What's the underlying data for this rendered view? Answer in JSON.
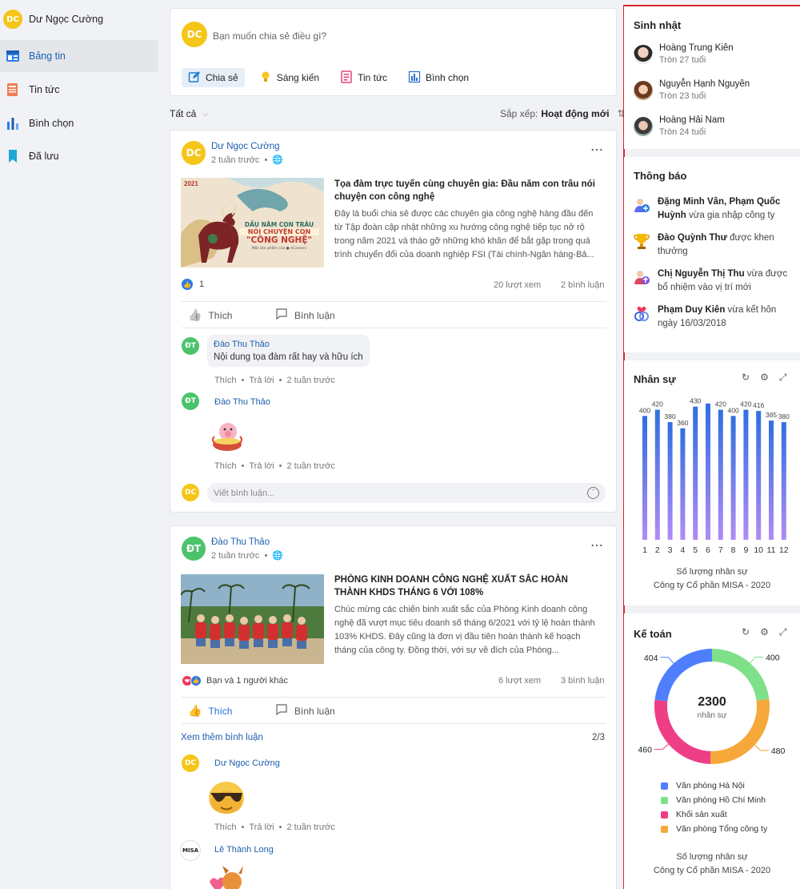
{
  "sidebar": {
    "user": {
      "initials": "DC",
      "name": "Dư Ngọc Cường"
    },
    "items": [
      {
        "label": "Bảng tin",
        "icon": "newsfeed-icon",
        "active": true
      },
      {
        "label": "Tin tức",
        "icon": "news-icon",
        "active": false
      },
      {
        "label": "Bình chọn",
        "icon": "poll-icon",
        "active": false
      },
      {
        "label": "Đã lưu",
        "icon": "bookmark-icon",
        "active": false
      }
    ]
  },
  "composer": {
    "initials": "DC",
    "placeholder": "Bạn muốn chia sẻ điều gì?",
    "tabs": [
      {
        "label": "Chia sẻ",
        "icon": "share-edit-icon"
      },
      {
        "label": "Sáng kiến",
        "icon": "lightbulb-icon"
      },
      {
        "label": "Tin tức",
        "icon": "news-icon"
      },
      {
        "label": "Bình chọn",
        "icon": "poll-icon"
      }
    ]
  },
  "filter": {
    "label": "Tất cả",
    "sort_prefix": "Sắp xếp:",
    "sort_value": "Hoạt động mới"
  },
  "posts": [
    {
      "author": "Dư Ngọc Cường",
      "initials": "DC",
      "time": "2 tuần trước",
      "title": "Tọa đàm trực tuyến cùng chuyên gia: Đầu năm con trâu nói chuyện con công nghệ",
      "excerpt": "Đây là buổi chia sẻ được các chuyên gia công nghệ hàng đầu đến từ Tập đoàn cập nhật những xu hướng công nghệ tiếp tục nở rộ trong năm 2021 và tháo gỡ những khó khăn để bắt gặp trong quá trình chuyển đổi của doanh nghiệp FSI (Tài chính-Ngân hàng-Bả...",
      "image_caption": {
        "year": "2021",
        "line1": "DẦU NĂM CON TRÂU",
        "line2": "NÓI CHUYỆN CON",
        "line3": "\"CÔNG NGHỆ\"",
        "footer": "Một sản phẩm của ● eCareers"
      },
      "reactions": "1",
      "views": "20 lượt xem",
      "comments": "2 bình luận",
      "like_label": "Thích",
      "comment_label": "Bình luận",
      "comment_list": [
        {
          "author": "Đào Thu Thảo",
          "initials": "ĐT",
          "text": "Nội dung tọa đàm rất hay và hữu ích",
          "like": "Thích",
          "reply": "Trả lời",
          "time": "2 tuần trước"
        },
        {
          "author": "Đào Thu Thảo",
          "initials": "ĐT",
          "sticker": "pig-sticker",
          "like": "Thích",
          "reply": "Trả lời",
          "time": "2 tuần trước"
        }
      ],
      "comment_input": {
        "initials": "DC",
        "placeholder": "Viết bình luận..."
      }
    },
    {
      "author": "Đào Thu Thảo",
      "initials": "ĐT",
      "time": "2 tuần trước",
      "title": "PHÒNG KINH DOANH CÔNG NGHỆ XUẤT SẮC HOÀN THÀNH KHDS THÁNG 6 VỚI 108%",
      "excerpt": "Chúc mừng các chiến binh xuất sắc của Phòng Kinh doanh công nghệ đã vượt mục tiêu doanh số tháng 6/2021 với tỷ lệ hoàn thành 103% KHDS. Đây cũng là đơn vị đầu tiên hoàn thành kế hoạch tháng của công ty. Đồng thời, với sự về đích của Phòng...",
      "reactions": "Bạn và 1 người khác",
      "views": "6 lượt xem",
      "comments": "3 bình luận",
      "like_label": "Thích",
      "comment_label": "Bình luận",
      "more_comments": "Xem thêm bình luận",
      "more_count": "2/3",
      "comment_list": [
        {
          "author": "Dư Ngọc Cường",
          "initials": "DC",
          "sticker": "sunglasses-sticker",
          "like": "Thích",
          "reply": "Trả lời",
          "time": "2 tuần trước"
        },
        {
          "author": "Lê Thành Long",
          "logo": "MISA",
          "sticker": "dog-sticker"
        }
      ]
    }
  ],
  "birthdays": {
    "title": "Sinh nhật",
    "people": [
      {
        "name": "Hoàng Trung Kiên",
        "age": "Tròn 27 tuổi"
      },
      {
        "name": "Nguyễn Hạnh Nguyên",
        "age": "Tròn 23 tuổi"
      },
      {
        "name": "Hoàng Hải Nam",
        "age": "Tròn 24 tuổi"
      }
    ]
  },
  "notifications": {
    "title": "Thông báo",
    "items": [
      {
        "icon": "new-member-icon",
        "bold": "Đặng Minh Vân, Phạm Quốc Huỳnh",
        "rest": " vừa gia nhập công ty"
      },
      {
        "icon": "trophy-icon",
        "bold": "Đào Quỳnh Thư",
        "rest": " được khen thưởng"
      },
      {
        "icon": "promotion-icon",
        "bold": "Chị Nguyễn Thị Thu",
        "rest": " vừa được bổ nhiệm vào vị trí mới"
      },
      {
        "icon": "wedding-rings-icon",
        "bold": "Phạm Duy Kiên",
        "rest": " vừa kết hôn ngày 16/03/2018"
      }
    ]
  },
  "hr_widget": {
    "title": "Nhân sự",
    "caption1": "Số lượng nhân sự",
    "caption2": "Công ty Cổ phần MISA - 2020"
  },
  "acc_widget": {
    "title": "Kế toán",
    "center_value": "2300",
    "center_label": "nhân sự",
    "caption1": "Số lượng nhân sự",
    "caption2": "Công ty Cổ phần MISA - 2020"
  },
  "chart_data": [
    {
      "type": "bar",
      "categories": [
        "1",
        "2",
        "3",
        "4",
        "5",
        "6",
        "7",
        "8",
        "9",
        "10",
        "11",
        "12"
      ],
      "values": [
        400,
        420,
        380,
        360,
        430,
        440,
        420,
        400,
        420,
        416,
        385,
        380
      ],
      "data_labels": [
        "400",
        "420",
        "380",
        "360",
        "430",
        "",
        "420",
        "400",
        "420",
        "416",
        "385",
        "380"
      ],
      "ylim": [
        0,
        450
      ],
      "colors": {
        "top": "#2f6fe0",
        "bottom": "#b18cf5"
      }
    },
    {
      "type": "pie",
      "donut": true,
      "series": [
        {
          "name": "Văn phòng Hà Nội",
          "value": 404,
          "color": "#4f7fff"
        },
        {
          "name": "Văn phòng Hồ Chí Minh",
          "value": 400,
          "color": "#7fe08a"
        },
        {
          "name": "Khối sản xuất",
          "value": 460,
          "color": "#ee3e86"
        },
        {
          "name": "Văn phòng Tổng công ty",
          "value": 480,
          "color": "#f6a93a"
        }
      ]
    }
  ]
}
